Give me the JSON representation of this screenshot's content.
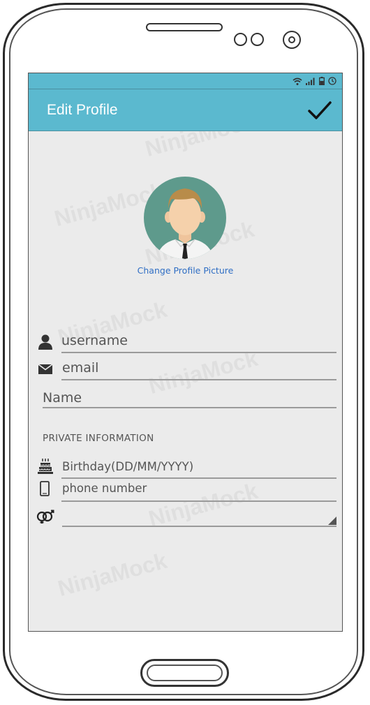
{
  "app": {
    "title": "Edit Profile",
    "confirm_icon": "checkmark-icon"
  },
  "status_bar": {
    "icons": [
      "wifi-icon",
      "signal-icon",
      "battery-icon",
      "clock-icon"
    ]
  },
  "watermark": {
    "text": "NinjaMock"
  },
  "profile": {
    "avatar_icon": "user-avatar-icon",
    "change_picture_label": "Change Profile Picture"
  },
  "form": {
    "username_placeholder": "username",
    "email_placeholder": "email",
    "name_placeholder": "Name",
    "private_section_label": "PRIVATE INFORMATION",
    "birthday_placeholder": "Birthday(DD/MM/YYYY)",
    "phone_placeholder": "phone number",
    "gender_value": ""
  },
  "colors": {
    "app_bar": "#5bb9cf",
    "screen_background": "#ebebeb",
    "link": "#2f6ec4",
    "avatar_background": "#5e9a8c"
  }
}
